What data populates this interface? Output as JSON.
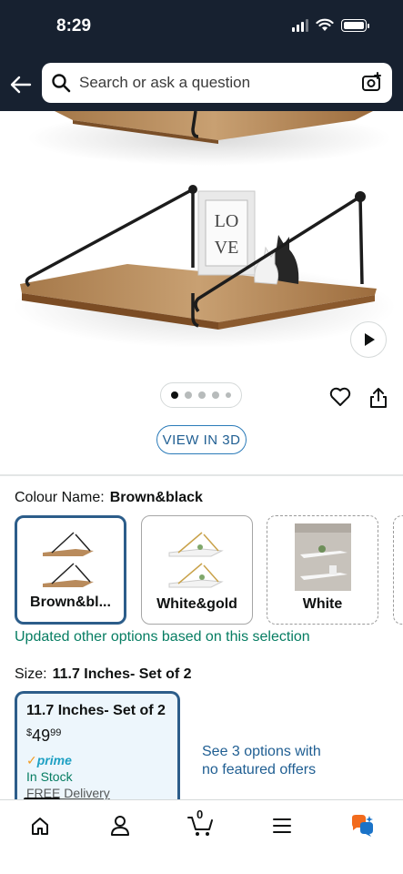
{
  "status_bar": {
    "time": "8:29"
  },
  "search": {
    "placeholder": "Search or ask a question"
  },
  "product": {
    "image_dots": 5,
    "active_dot": 0,
    "view_3d_label": "VIEW IN 3D"
  },
  "colour": {
    "label": "Colour Name:",
    "selected": "Brown&black",
    "options": [
      {
        "name": "Brown&bl..."
      },
      {
        "name": "White&gold"
      },
      {
        "name": "White"
      }
    ],
    "updated_note": "Updated other options based on this selection"
  },
  "size": {
    "label": "Size:",
    "selected": "11.7 Inches- Set of 2",
    "card": {
      "title": "11.7 Inches- Set of 2",
      "price_currency": "$",
      "price_whole": "49",
      "price_fraction": "99",
      "prime_label": "prime",
      "stock": "In Stock",
      "delivery": "FREE Delivery"
    },
    "see_options_line1": "See 3 options with",
    "see_options_line2": "no featured offers"
  },
  "bottom_nav": {
    "cart_count": "0",
    "items": [
      "home-icon",
      "account-icon",
      "cart-icon",
      "menu-icon",
      "rufus-icon"
    ]
  },
  "colors": {
    "header_bg": "#172130",
    "link_blue": "#1f5e92",
    "green": "#067d62",
    "selected_border": "#2c5d8a"
  }
}
